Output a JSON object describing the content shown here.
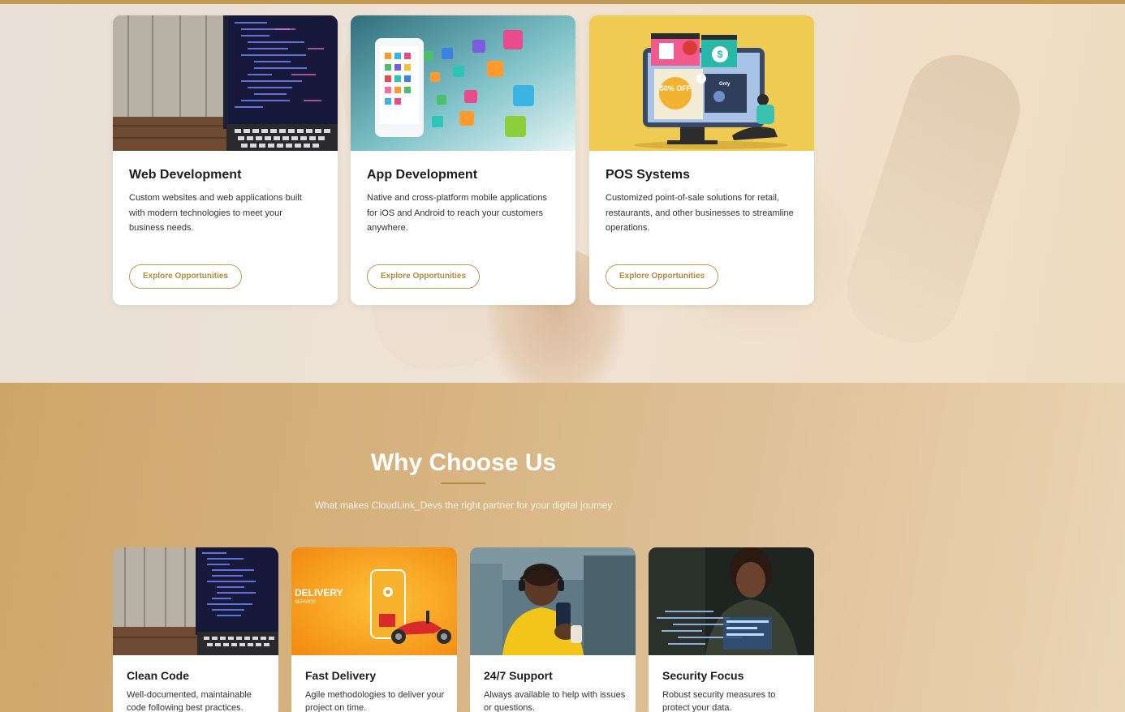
{
  "services": {
    "cards": [
      {
        "title": "Web Development",
        "description": "Custom websites and web applications built with modern technologies to meet your business needs.",
        "button": "Explore Opportunities"
      },
      {
        "title": "App Development",
        "description": "Native and cross-platform mobile applications for iOS and Android to reach your customers anywhere.",
        "button": "Explore Opportunities"
      },
      {
        "title": "POS Systems",
        "description": "Customized point-of-sale solutions for retail, restaurants, and other businesses to streamline operations.",
        "button": "Explore Opportunities"
      }
    ],
    "pos_image_text": {
      "discount": "50% OFF",
      "only": "Only"
    }
  },
  "why": {
    "title": "Why Choose Us",
    "subtitle": "What makes CloudLink_Devs the right partner for your digital journey",
    "features": [
      {
        "title": "Clean Code",
        "description": "Well-documented, maintainable code following best practices."
      },
      {
        "title": "Fast Delivery",
        "description": "Agile methodologies to deliver your project on time."
      },
      {
        "title": "24/7 Support",
        "description": "Always available to help with issues or questions."
      },
      {
        "title": "Security Focus",
        "description": "Robust security measures to protect your data."
      }
    ],
    "delivery_image_text": {
      "word": "DELIVERY",
      "sub": "SERVICE"
    }
  },
  "colors": {
    "accent": "#c29a52",
    "accent_dark": "#b58a3e",
    "section_gold": "#d6b27e"
  }
}
